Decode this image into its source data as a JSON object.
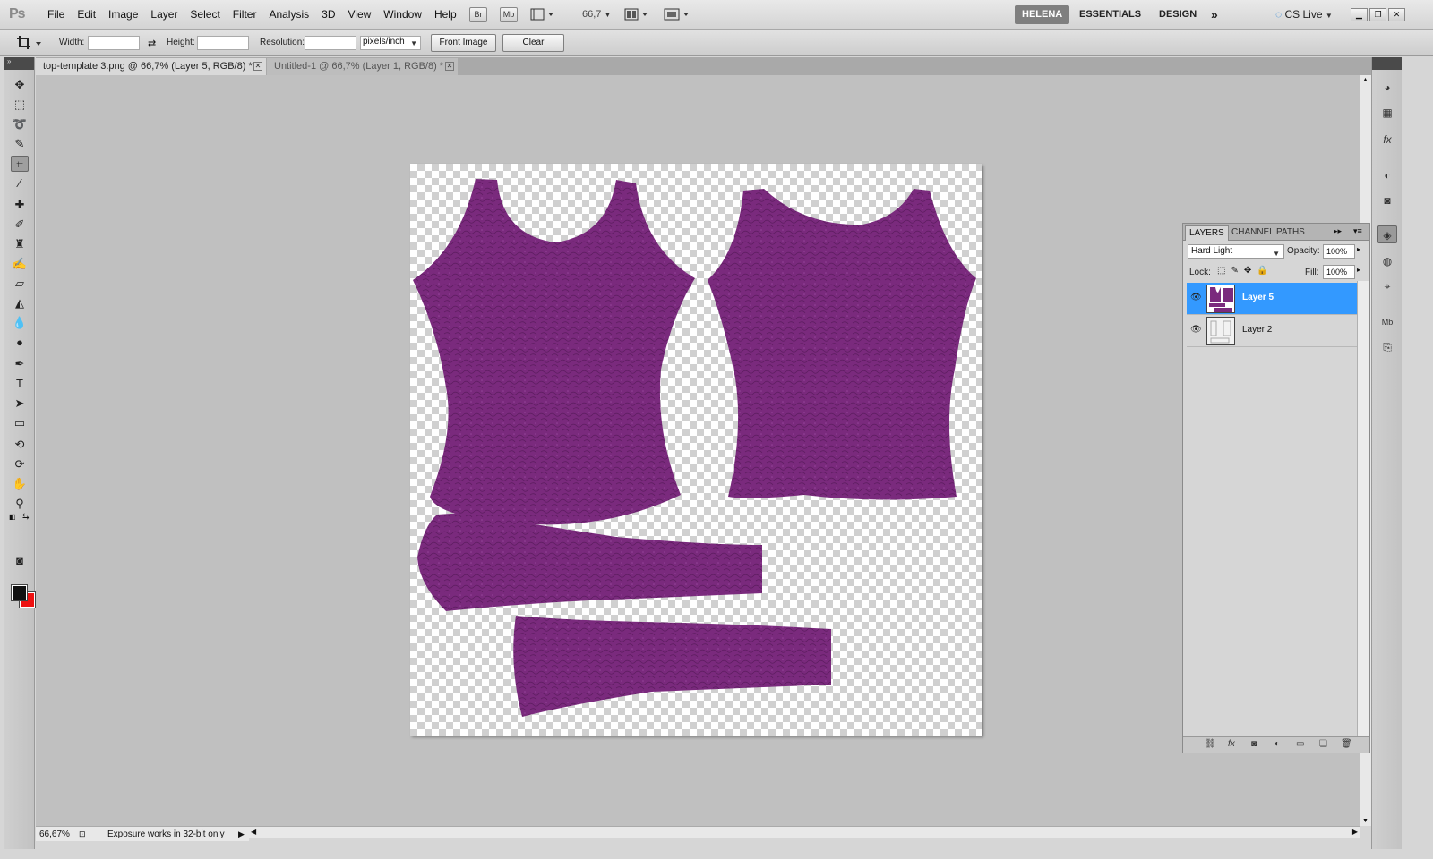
{
  "app": {
    "logo": "Ps"
  },
  "menu": [
    "File",
    "Edit",
    "Image",
    "Layer",
    "Select",
    "Filter",
    "Analysis",
    "3D",
    "View",
    "Window",
    "Help"
  ],
  "appbar": {
    "bridge": "Br",
    "minibridge": "Mb",
    "zoom": "66,7"
  },
  "workspaces": {
    "active": "HELENA",
    "essentials": "ESSENTIALS",
    "design": "DESIGN",
    "more": "»"
  },
  "cslive": "CS Live",
  "options": {
    "width_label": "Width:",
    "width_value": "",
    "height_label": "Height:",
    "height_value": "",
    "resolution_label": "Resolution:",
    "resolution_value": "",
    "units": "pixels/inch",
    "front_image": "Front Image",
    "clear": "Clear"
  },
  "tabs": [
    {
      "title": "top-template 3.png @ 66,7% (Layer 5, RGB/8) *",
      "active": true
    },
    {
      "title": "Untitled-1 @ 66,7% (Layer 1, RGB/8) *",
      "active": false
    }
  ],
  "status": {
    "zoom": "66,67%",
    "message": "Exposure works in 32-bit only"
  },
  "layers_panel": {
    "tabs": [
      "LAYERS",
      "CHANNEL",
      "PATHS"
    ],
    "blend_mode": "Hard Light",
    "opacity_label": "Opacity:",
    "opacity_value": "100%",
    "lock_label": "Lock:",
    "fill_label": "Fill:",
    "fill_value": "100%",
    "layers": [
      {
        "name": "Layer 5",
        "selected": true
      },
      {
        "name": "Layer 2",
        "selected": false
      }
    ]
  },
  "colors": {
    "garment": "#7a2a7d",
    "foreground": "#111111",
    "background": "#e11111",
    "selection": "#3399ff"
  }
}
